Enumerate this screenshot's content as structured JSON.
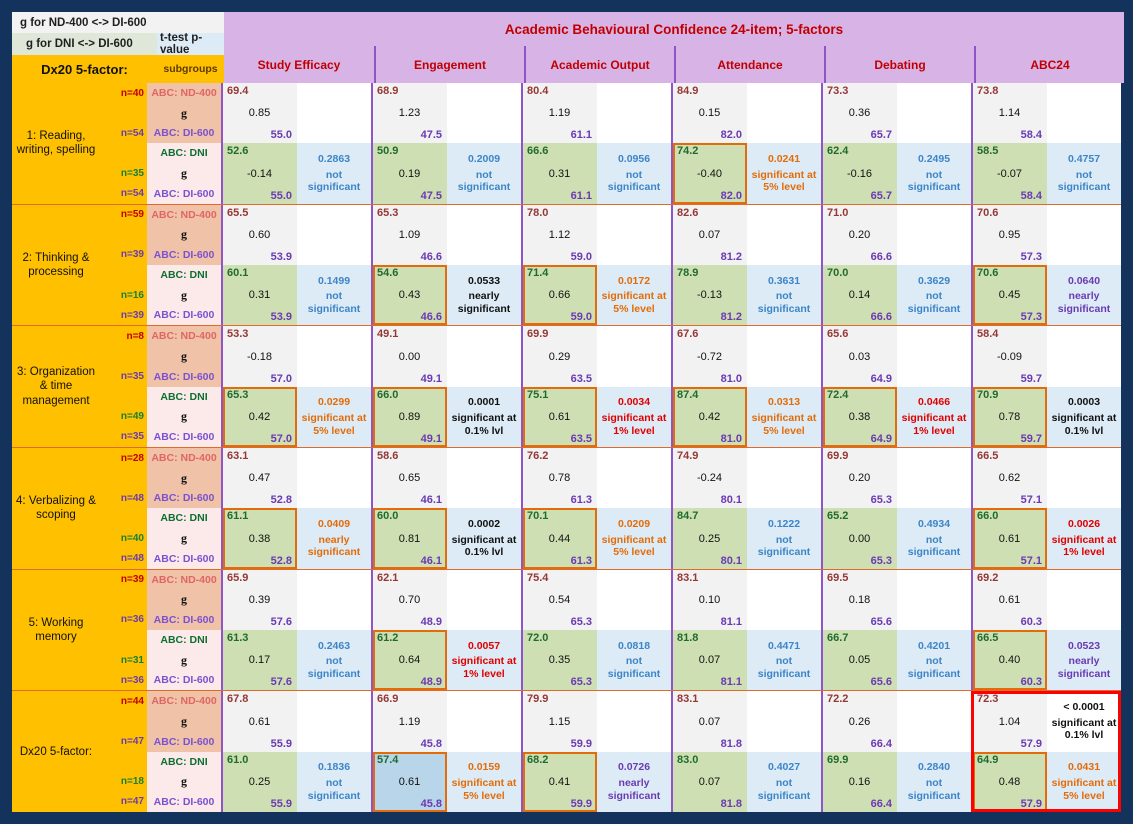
{
  "legend": {
    "line1": "g for ND-400 <-> DI-600",
    "line2": "g for DNI <-> DI-600",
    "ttest": "t-test p-value",
    "row_header": "Dx20 5-factor:",
    "subgroups": "subgroups"
  },
  "banner": "Academic Behavioural Confidence 24-item; 5-factors",
  "factors": [
    "Study Efficacy",
    "Engagement",
    "Academic Output",
    "Attendance",
    "Debating",
    "ABC24"
  ],
  "labels": {
    "nd": "ABC: ND-400",
    "di": "ABC: DI-600",
    "dni": "ABC: DNI",
    "g": "g"
  },
  "blocks": [
    {
      "name": "1: Reading, writing, spelling",
      "n_nd": "n=40",
      "n_di_top": "n=54",
      "n_dni": "n=35",
      "n_di_bot": "n=54",
      "top": [
        {
          "v1": "69.4",
          "v2": "0.85",
          "v3": "55.0"
        },
        {
          "v1": "68.9",
          "v2": "1.23",
          "v3": "47.5"
        },
        {
          "v1": "80.4",
          "v2": "1.19",
          "v3": "61.1"
        },
        {
          "v1": "84.9",
          "v2": "0.15",
          "v3": "82.0"
        },
        {
          "v1": "73.3",
          "v2": "0.36",
          "v3": "65.7"
        },
        {
          "v1": "73.8",
          "v2": "1.14",
          "v3": "58.4"
        }
      ],
      "top_p": [
        "",
        "",
        "",
        "",
        "",
        ""
      ],
      "top_p_text": [
        "",
        "",
        "",
        "",
        "",
        ""
      ],
      "bot": [
        {
          "v1": "52.6",
          "v2": "-0.14",
          "v3": "55.0",
          "box": false,
          "bg": "grn"
        },
        {
          "v1": "50.9",
          "v2": "0.19",
          "v3": "47.5",
          "box": false,
          "bg": "grn"
        },
        {
          "v1": "66.6",
          "v2": "0.31",
          "v3": "61.1",
          "box": false,
          "bg": "grn"
        },
        {
          "v1": "74.2",
          "v2": "-0.40",
          "v3": "82.0",
          "box": true,
          "bg": "grn"
        },
        {
          "v1": "62.4",
          "v2": "-0.16",
          "v3": "65.7",
          "box": false,
          "bg": "grn"
        },
        {
          "v1": "58.5",
          "v2": "-0.07",
          "v3": "58.4",
          "box": false,
          "bg": "grn"
        }
      ],
      "bot_p": [
        "0.2863",
        "0.2009",
        "0.0956",
        "0.0241",
        "0.2495",
        "0.4757"
      ],
      "bot_p_text": [
        "not significant",
        "not significant",
        "not significant",
        "significant at 5% level",
        "not significant",
        "not significant"
      ],
      "bot_p_cls": [
        "ns",
        "ns",
        "ns",
        "s5",
        "ns",
        "ns"
      ]
    },
    {
      "name": "2: Thinking & processing",
      "n_nd": "n=59",
      "n_di_top": "n=39",
      "n_dni": "n=16",
      "n_di_bot": "n=39",
      "top": [
        {
          "v1": "65.5",
          "v2": "0.60",
          "v3": "53.9"
        },
        {
          "v1": "65.3",
          "v2": "1.09",
          "v3": "46.6"
        },
        {
          "v1": "78.0",
          "v2": "1.12",
          "v3": "59.0"
        },
        {
          "v1": "82.6",
          "v2": "0.07",
          "v3": "81.2"
        },
        {
          "v1": "71.0",
          "v2": "0.20",
          "v3": "66.6"
        },
        {
          "v1": "70.6",
          "v2": "0.95",
          "v3": "57.3"
        }
      ],
      "top_p": [
        "",
        "",
        "",
        "",
        "",
        ""
      ],
      "top_p_text": [
        "",
        "",
        "",
        "",
        "",
        ""
      ],
      "bot": [
        {
          "v1": "60.1",
          "v2": "0.31",
          "v3": "53.9",
          "box": false,
          "bg": "grn"
        },
        {
          "v1": "54.6",
          "v2": "0.43",
          "v3": "46.6",
          "box": true,
          "bg": "grn"
        },
        {
          "v1": "71.4",
          "v2": "0.66",
          "v3": "59.0",
          "box": true,
          "bg": "grn"
        },
        {
          "v1": "78.9",
          "v2": "-0.13",
          "v3": "81.2",
          "box": false,
          "bg": "grn"
        },
        {
          "v1": "70.0",
          "v2": "0.14",
          "v3": "66.6",
          "box": false,
          "bg": "grn"
        },
        {
          "v1": "70.6",
          "v2": "0.45",
          "v3": "57.3",
          "box": true,
          "bg": "grn"
        }
      ],
      "bot_p": [
        "0.1499",
        "0.0533",
        "0.0172",
        "0.3631",
        "0.3629",
        "0.0640"
      ],
      "bot_p_text": [
        "not significant",
        "nearly significant",
        "significant at 5% level",
        "not significant",
        "not significant",
        "nearly significant"
      ],
      "bot_p_cls": [
        "ns",
        "nearblk",
        "s5",
        "ns",
        "ns",
        "near"
      ]
    },
    {
      "name": "3: Organization & time management",
      "n_nd": "n=8",
      "n_di_top": "n=35",
      "n_dni": "n=49",
      "n_di_bot": "n=35",
      "top": [
        {
          "v1": "53.3",
          "v2": "-0.18",
          "v3": "57.0"
        },
        {
          "v1": "49.1",
          "v2": "0.00",
          "v3": "49.1"
        },
        {
          "v1": "69.9",
          "v2": "0.29",
          "v3": "63.5"
        },
        {
          "v1": "67.6",
          "v2": "-0.72",
          "v3": "81.0"
        },
        {
          "v1": "65.6",
          "v2": "0.03",
          "v3": "64.9"
        },
        {
          "v1": "58.4",
          "v2": "-0.09",
          "v3": "59.7"
        }
      ],
      "top_p": [
        "",
        "",
        "",
        "",
        "",
        ""
      ],
      "top_p_text": [
        "",
        "",
        "",
        "",
        "",
        ""
      ],
      "bot": [
        {
          "v1": "65.3",
          "v2": "0.42",
          "v3": "57.0",
          "box": true,
          "bg": "grn"
        },
        {
          "v1": "66.0",
          "v2": "0.89",
          "v3": "49.1",
          "box": true,
          "bg": "grn"
        },
        {
          "v1": "75.1",
          "v2": "0.61",
          "v3": "63.5",
          "box": true,
          "bg": "grn"
        },
        {
          "v1": "87.4",
          "v2": "0.42",
          "v3": "81.0",
          "box": true,
          "bg": "grn"
        },
        {
          "v1": "72.4",
          "v2": "0.38",
          "v3": "64.9",
          "box": true,
          "bg": "grn"
        },
        {
          "v1": "70.9",
          "v2": "0.78",
          "v3": "59.7",
          "box": true,
          "bg": "grn"
        }
      ],
      "bot_p": [
        "0.0299",
        "0.0001",
        "0.0034",
        "0.0313",
        "0.0466",
        "0.0003"
      ],
      "bot_p_text": [
        "significant at 5% level",
        "significant at 0.1% lvl",
        "significant at 1% level",
        "significant at 5% level",
        "significant at 1% level",
        "significant at 0.1% lvl"
      ],
      "bot_p_cls": [
        "s5",
        "s01",
        "s1",
        "s5",
        "s1",
        "s01"
      ]
    },
    {
      "name": "4: Verbalizing & scoping",
      "n_nd": "n=28",
      "n_di_top": "n=48",
      "n_dni": "n=40",
      "n_di_bot": "n=48",
      "top": [
        {
          "v1": "63.1",
          "v2": "0.47",
          "v3": "52.8"
        },
        {
          "v1": "58.6",
          "v2": "0.65",
          "v3": "46.1"
        },
        {
          "v1": "76.2",
          "v2": "0.78",
          "v3": "61.3"
        },
        {
          "v1": "74.9",
          "v2": "-0.24",
          "v3": "80.1"
        },
        {
          "v1": "69.9",
          "v2": "0.20",
          "v3": "65.3"
        },
        {
          "v1": "66.5",
          "v2": "0.62",
          "v3": "57.1"
        }
      ],
      "top_p": [
        "",
        "",
        "",
        "",
        "",
        ""
      ],
      "top_p_text": [
        "",
        "",
        "",
        "",
        "",
        ""
      ],
      "bot": [
        {
          "v1": "61.1",
          "v2": "0.38",
          "v3": "52.8",
          "box": true,
          "bg": "grn"
        },
        {
          "v1": "60.0",
          "v2": "0.81",
          "v3": "46.1",
          "box": true,
          "bg": "grn"
        },
        {
          "v1": "70.1",
          "v2": "0.44",
          "v3": "61.3",
          "box": true,
          "bg": "grn"
        },
        {
          "v1": "84.7",
          "v2": "0.25",
          "v3": "80.1",
          "box": false,
          "bg": "grn"
        },
        {
          "v1": "65.2",
          "v2": "0.00",
          "v3": "65.3",
          "box": false,
          "bg": "grn"
        },
        {
          "v1": "66.0",
          "v2": "0.61",
          "v3": "57.1",
          "box": true,
          "bg": "grn"
        }
      ],
      "bot_p": [
        "0.0409",
        "0.0002",
        "0.0209",
        "0.1222",
        "0.4934",
        "0.0026"
      ],
      "bot_p_text": [
        "nearly significant",
        "significant at 0.1% lvl",
        "significant at 5% level",
        "not significant",
        "not significant",
        "significant at 1% level"
      ],
      "bot_p_cls": [
        "s5",
        "s01",
        "s5",
        "ns",
        "ns",
        "s1"
      ]
    },
    {
      "name": "5: Working memory",
      "n_nd": "n=39",
      "n_di_top": "n=36",
      "n_dni": "n=31",
      "n_di_bot": "n=36",
      "top": [
        {
          "v1": "65.9",
          "v2": "0.39",
          "v3": "57.6"
        },
        {
          "v1": "62.1",
          "v2": "0.70",
          "v3": "48.9"
        },
        {
          "v1": "75.4",
          "v2": "0.54",
          "v3": "65.3"
        },
        {
          "v1": "83.1",
          "v2": "0.10",
          "v3": "81.1"
        },
        {
          "v1": "69.5",
          "v2": "0.18",
          "v3": "65.6"
        },
        {
          "v1": "69.2",
          "v2": "0.61",
          "v3": "60.3"
        }
      ],
      "top_p": [
        "",
        "",
        "",
        "",
        "",
        ""
      ],
      "top_p_text": [
        "",
        "",
        "",
        "",
        "",
        ""
      ],
      "bot": [
        {
          "v1": "61.3",
          "v2": "0.17",
          "v3": "57.6",
          "box": false,
          "bg": "grn"
        },
        {
          "v1": "61.2",
          "v2": "0.64",
          "v3": "48.9",
          "box": true,
          "bg": "grn"
        },
        {
          "v1": "72.0",
          "v2": "0.35",
          "v3": "65.3",
          "box": false,
          "bg": "grn"
        },
        {
          "v1": "81.8",
          "v2": "0.07",
          "v3": "81.1",
          "box": false,
          "bg": "grn"
        },
        {
          "v1": "66.7",
          "v2": "0.05",
          "v3": "65.6",
          "box": false,
          "bg": "grn"
        },
        {
          "v1": "66.5",
          "v2": "0.40",
          "v3": "60.3",
          "box": true,
          "bg": "grn"
        }
      ],
      "bot_p": [
        "0.2463",
        "0.0057",
        "0.0818",
        "0.4471",
        "0.4201",
        "0.0523"
      ],
      "bot_p_text": [
        "not significant",
        "significant at 1% level",
        "not significant",
        "not significant",
        "not significant",
        "nearly significant"
      ],
      "bot_p_cls": [
        "ns",
        "s1",
        "ns",
        "ns",
        "ns",
        "near"
      ]
    },
    {
      "name": "Dx20 5-factor:",
      "n_nd": "n=44",
      "n_di_top": "n=47",
      "n_dni": "n=18",
      "n_di_bot": "n=47",
      "top": [
        {
          "v1": "67.8",
          "v2": "0.61",
          "v3": "55.9"
        },
        {
          "v1": "66.9",
          "v2": "1.19",
          "v3": "45.8"
        },
        {
          "v1": "79.9",
          "v2": "1.15",
          "v3": "59.9"
        },
        {
          "v1": "83.1",
          "v2": "0.07",
          "v3": "81.8"
        },
        {
          "v1": "72.2",
          "v2": "0.26",
          "v3": "66.4"
        },
        {
          "v1": "72.3",
          "v2": "1.04",
          "v3": "57.9"
        }
      ],
      "top_p": [
        "",
        "",
        "",
        "",
        "",
        "< 0.0001"
      ],
      "top_p_text": [
        "",
        "",
        "",
        "",
        "",
        "significant at 0.1% lvl"
      ],
      "top_p_cls": [
        "",
        "",
        "",
        "",
        "",
        "s01"
      ],
      "bot": [
        {
          "v1": "61.0",
          "v2": "0.25",
          "v3": "55.9",
          "box": false,
          "bg": "grn"
        },
        {
          "v1": "57.4",
          "v2": "0.61",
          "v3": "45.8",
          "box": true,
          "bg": "blu"
        },
        {
          "v1": "68.2",
          "v2": "0.41",
          "v3": "59.9",
          "box": true,
          "bg": "grn"
        },
        {
          "v1": "83.0",
          "v2": "0.07",
          "v3": "81.8",
          "box": false,
          "bg": "grn"
        },
        {
          "v1": "69.9",
          "v2": "0.16",
          "v3": "66.4",
          "box": false,
          "bg": "grn"
        },
        {
          "v1": "64.9",
          "v2": "0.48",
          "v3": "57.9",
          "box": true,
          "bg": "grn"
        }
      ],
      "bot_p": [
        "0.1836",
        "0.0159",
        "0.0726",
        "0.4027",
        "0.2840",
        "0.0431"
      ],
      "bot_p_text": [
        "not significant",
        "significant at 5% level",
        "nearly significant",
        "not significant",
        "not significant",
        "significant at 5% level"
      ],
      "bot_p_cls": [
        "ns",
        "s5",
        "near",
        "ns",
        "ns",
        "s5"
      ]
    }
  ],
  "colors": {
    "page_bg": "#13325c",
    "header_purple": "#d8b3e6",
    "label_orange": "#ffc000",
    "sig_green": "#cfdfb4",
    "sig_blue": "#b9d5ea",
    "p_bg": "#dcebf5",
    "red_highlight": "#ff0000"
  }
}
